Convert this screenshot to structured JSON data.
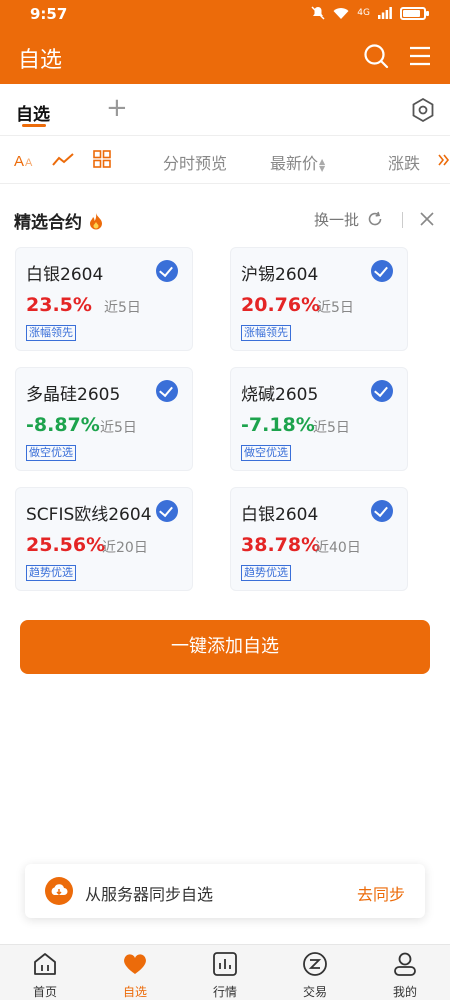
{
  "status_bar": {
    "time": "9:57",
    "network": "4G"
  },
  "header": {
    "title": "自选"
  },
  "tabs": {
    "active": "自选",
    "add": "+"
  },
  "toolbar": {
    "columns": [
      {
        "label": "分时预览"
      },
      {
        "label": "最新价"
      },
      {
        "label": "涨跌"
      }
    ]
  },
  "section": {
    "title": "精选合约",
    "refresh_label": "换一批"
  },
  "cards": [
    {
      "name": "白银2604",
      "change": "23.5%",
      "period": "近5日",
      "tag": "涨幅领先",
      "direction": "up"
    },
    {
      "name": "沪锡2604",
      "change": "20.76%",
      "period": "近5日",
      "tag": "涨幅领先",
      "direction": "up"
    },
    {
      "name": "多晶硅2605",
      "change": "-8.87%",
      "period": "近5日",
      "tag": "做空优选",
      "direction": "down"
    },
    {
      "name": "烧碱2605",
      "change": "-7.18%",
      "period": "近5日",
      "tag": "做空优选",
      "direction": "down"
    },
    {
      "name": "SCFIS欧线2604",
      "change": "25.56%",
      "period": "近20日",
      "tag": "趋势优选",
      "direction": "up"
    },
    {
      "name": "白银2604",
      "change": "38.78%",
      "period": "近40日",
      "tag": "趋势优选",
      "direction": "up"
    }
  ],
  "add_button": {
    "label": "一键添加自选"
  },
  "sync": {
    "text": "从服务器同步自选",
    "action": "去同步"
  },
  "bottom_nav": [
    {
      "label": "首页",
      "icon": "home-icon"
    },
    {
      "label": "自选",
      "icon": "heart-icon",
      "active": true
    },
    {
      "label": "行情",
      "icon": "chart-icon"
    },
    {
      "label": "交易",
      "icon": "trade-icon"
    },
    {
      "label": "我的",
      "icon": "profile-icon"
    }
  ],
  "colors": {
    "brand": "#EC6B0A",
    "up": "#E42525",
    "down": "#1DA34D",
    "tag": "#3A6FD8"
  }
}
